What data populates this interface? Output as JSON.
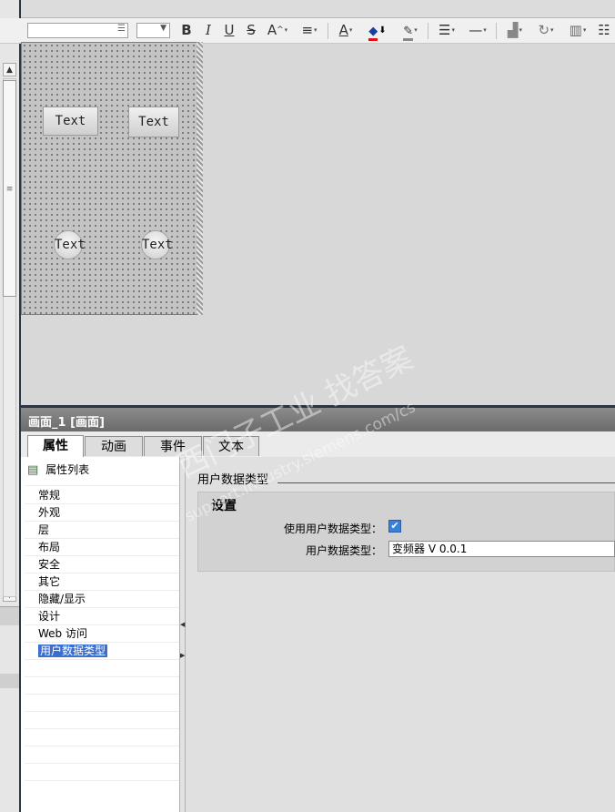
{
  "toolbar": {
    "font_field_value": "",
    "size_field_value": "",
    "bold_label": "B",
    "italic_label": "I",
    "underline_label": "U",
    "strike_label": "S",
    "font_size_label": "A",
    "align_label": "≡",
    "font_color_label": "A"
  },
  "canvas": {
    "buttons": [
      "Text",
      "Text"
    ],
    "round_buttons": [
      "Text",
      "Text"
    ]
  },
  "inspector": {
    "title": "画面_1 [画面]",
    "tabs": [
      {
        "label": "属性"
      },
      {
        "label": "动画"
      },
      {
        "label": "事件"
      },
      {
        "label": "文本"
      }
    ],
    "nav_header": "属性列表",
    "nav_items": [
      "常规",
      "外观",
      "层",
      "布局",
      "安全",
      "其它",
      "隐藏/显示",
      "设计",
      "Web 访问",
      "用户数据类型"
    ],
    "section_title": "用户数据类型",
    "group_title": "设置",
    "use_udt_label": "使用用户数据类型：",
    "use_udt_checked": true,
    "udt_label": "用户数据类型：",
    "udt_value": "变频器 V 0.0.1"
  },
  "watermark": {
    "line1": "西门子工业   找答案",
    "line2": "support.industry.siemens.com/cs"
  },
  "colors": {
    "title_bar": "#6b6b6b",
    "separator": "#2b3545",
    "selection": "#3a6fd0",
    "checkbox": "#3b7fd6"
  }
}
